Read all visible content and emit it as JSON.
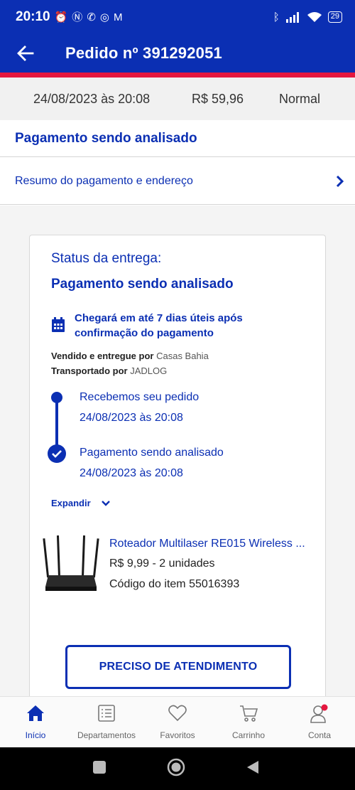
{
  "status_bar": {
    "time": "20:10",
    "battery": "29",
    "left_icons": [
      "alarm-icon",
      "nfc-icon",
      "whatsapp-icon",
      "instagram-icon",
      "gmail-icon"
    ],
    "right_icons": [
      "bluetooth-icon",
      "signal-icon",
      "wifi-icon",
      "battery-icon"
    ]
  },
  "app_bar": {
    "title": "Pedido nº 391292051"
  },
  "order_summary": {
    "date": "24/08/2023 às 20:08",
    "total": "R$ 59,96",
    "shipping_type": "Normal"
  },
  "payment_header": "Pagamento sendo analisado",
  "resume_link": "Resumo do pagamento e endereço",
  "delivery": {
    "status_label": "Status da entrega:",
    "status_value": "Pagamento sendo analisado",
    "arrival_text": "Chegará em até 7 dias úteis após confirmação do pagamento",
    "seller_prefix": "Vendido e entregue por",
    "seller_name": "Casas Bahia",
    "carrier_prefix": "Transportado por",
    "carrier_name": "JADLOG",
    "timeline": [
      {
        "title": "Recebemos seu pedido",
        "date": "24/08/2023 às 20:08"
      },
      {
        "title": "Pagamento sendo analisado",
        "date": "24/08/2023 às 20:08"
      }
    ],
    "expand_label": "Expandir"
  },
  "product": {
    "name": "Roteador Multilaser RE015 Wireless ...",
    "price_qty": "R$ 9,99 - 2 unidades",
    "code": "Código do item 55016393"
  },
  "help_button": "PRECISO DE ATENDIMENTO",
  "bottom_nav": [
    {
      "label": "Início",
      "icon": "home-icon",
      "active": true
    },
    {
      "label": "Departamentos",
      "icon": "list-icon",
      "active": false
    },
    {
      "label": "Favoritos",
      "icon": "heart-icon",
      "active": false
    },
    {
      "label": "Carrinho",
      "icon": "cart-icon",
      "active": false
    },
    {
      "label": "Conta",
      "icon": "user-icon",
      "active": false
    }
  ],
  "colors": {
    "primary": "#0b2fb3",
    "accent_red": "#e5173f"
  }
}
